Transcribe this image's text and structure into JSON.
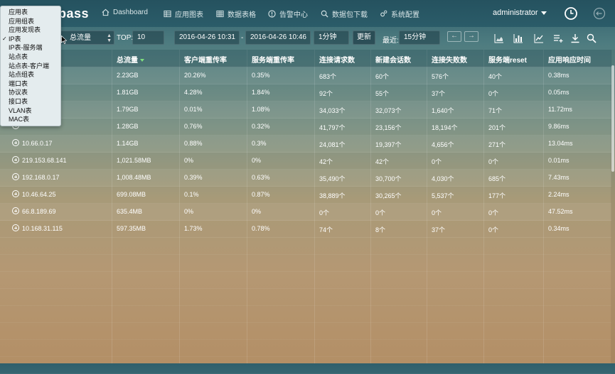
{
  "app": {
    "logo_text": "pass"
  },
  "nav": [
    {
      "label": "Dashboard",
      "icon": "home-icon"
    },
    {
      "label": "应用图表",
      "icon": "chart-grid-icon"
    },
    {
      "label": "数据表格",
      "icon": "table-icon"
    },
    {
      "label": "告警中心",
      "icon": "alert-icon"
    },
    {
      "label": "数据包下载",
      "icon": "search-icon"
    },
    {
      "label": "系统配置",
      "icon": "gear-icon"
    }
  ],
  "user": {
    "name": "administrator"
  },
  "toolbar": {
    "select_value": "总流量",
    "top_label": "TOP:",
    "top_value": "10",
    "start_time": "2016-04-26 10:31",
    "time_separator": "-",
    "end_time": "2016-04-26 10:46",
    "interval": "1分钟",
    "refresh_label": "更新",
    "recent_label": "最近:",
    "recent_value": "15分钟",
    "prev_label": "←",
    "next_label": "→"
  },
  "dropdown": {
    "items": [
      {
        "label": "应用表",
        "checked": false
      },
      {
        "label": "应用组表",
        "checked": false
      },
      {
        "label": "应用发现表",
        "checked": false
      },
      {
        "label": "IP表",
        "checked": true
      },
      {
        "label": "IP表-服务端",
        "checked": false
      },
      {
        "label": "站点表",
        "checked": false
      },
      {
        "label": "站点表-客户端",
        "checked": false
      },
      {
        "label": "站点组表",
        "checked": false
      },
      {
        "label": "端口表",
        "checked": false
      },
      {
        "label": "协议表",
        "checked": false
      },
      {
        "label": "接口表",
        "checked": false
      },
      {
        "label": "VLAN表",
        "checked": false
      },
      {
        "label": "MAC表",
        "checked": false
      }
    ]
  },
  "table": {
    "columns": [
      "",
      "总流量",
      "客户端重传率",
      "服务端重传率",
      "连接请求数",
      "新建会话数",
      "连接失败数",
      "服务端reset",
      "应用响应时间"
    ],
    "sorted_column": "总流量",
    "rows": [
      [
        "",
        "2.23GB",
        "20.26%",
        "0.35%",
        "683个",
        "60个",
        "576个",
        "40个",
        "0.38ms"
      ],
      [
        "",
        "1.81GB",
        "4.28%",
        "1.84%",
        "92个",
        "55个",
        "37个",
        "0个",
        "0.05ms"
      ],
      [
        "",
        "1.79GB",
        "0.01%",
        "1.08%",
        "34,033个",
        "32,073个",
        "1,640个",
        "71个",
        "11.72ms"
      ],
      [
        "",
        "1.28GB",
        "0.76%",
        "0.32%",
        "41,797个",
        "23,156个",
        "18,194个",
        "201个",
        "9.86ms"
      ],
      [
        "10.66.0.17",
        "1.14GB",
        "0.88%",
        "0.3%",
        "24,081个",
        "19,397个",
        "4,656个",
        "271个",
        "13.04ms"
      ],
      [
        "219.153.68.141",
        "1,021.58MB",
        "0%",
        "0%",
        "42个",
        "42个",
        "0个",
        "0个",
        "0.01ms"
      ],
      [
        "192.168.0.17",
        "1,008.48MB",
        "0.39%",
        "0.63%",
        "35,490个",
        "30,700个",
        "4,030个",
        "685个",
        "7.43ms"
      ],
      [
        "10.46.64.25",
        "699.08MB",
        "0.1%",
        "0.87%",
        "38,889个",
        "30,265个",
        "5,537个",
        "177个",
        "2.24ms"
      ],
      [
        "66.8.189.69",
        "635.4MB",
        "0%",
        "0%",
        "0个",
        "0个",
        "0个",
        "0个",
        "47.52ms"
      ],
      [
        "10.168.31.115",
        "597.35MB",
        "1.73%",
        "0.78%",
        "74个",
        "8个",
        "37个",
        "0个",
        "0.34ms"
      ]
    ]
  }
}
